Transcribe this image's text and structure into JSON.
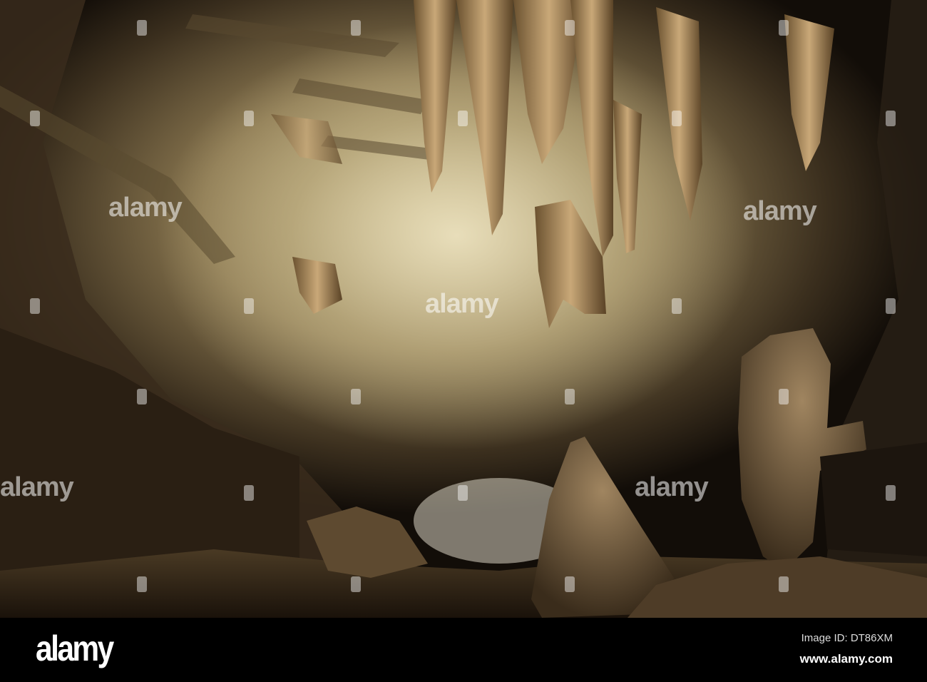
{
  "photo": {
    "subject": "cave",
    "watermark": "alamy"
  },
  "footer": {
    "logo": "alamy",
    "image_id": "Image ID: DT86XM",
    "url": "www.alamy.com"
  }
}
